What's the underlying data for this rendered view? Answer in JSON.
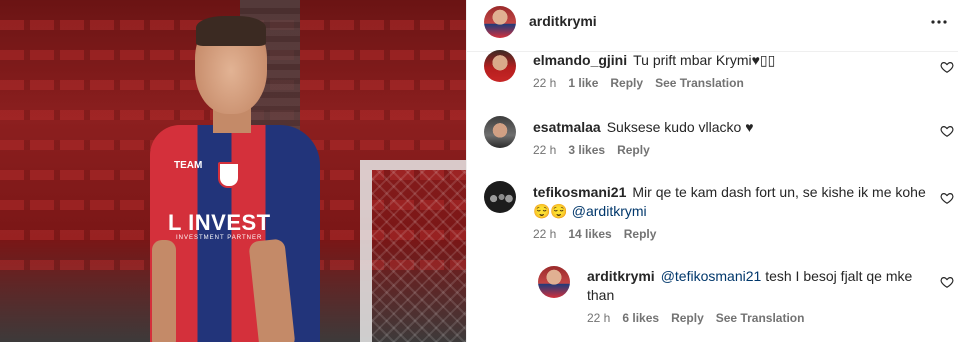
{
  "post": {
    "author": "arditkrymi",
    "more_icon": "more-horizontal-icon",
    "photo_sponsor": "L INVEST",
    "photo_sponsor_sub": "INVESTMENT PARTNER",
    "photo_kit_logo": "TEAM"
  },
  "comments": [
    {
      "user": "elmando_gjini",
      "text": "Tu prift mbar Krymi♥▯▯",
      "time": "22 h",
      "likes": "1 like",
      "reply": "Reply",
      "translation": "See Translation"
    },
    {
      "user": "esatmalaa",
      "text": "Suksese kudo vllacko ♥",
      "time": "22 h",
      "likes": "3 likes",
      "reply": "Reply"
    },
    {
      "user": "tefikosmani21",
      "text_line1": "Mir qe te kam dash fort un, se kishe ik me kohe",
      "text_line2_emoji": "😌😌",
      "mention": "@arditkrymi",
      "time": "22 h",
      "likes": "14 likes",
      "reply": "Reply"
    }
  ],
  "reply": {
    "user": "arditkrymi",
    "mention": "@tefikosmani21",
    "text_line1": "tesh I besoj fjalt qe mke",
    "text_line2": "than",
    "time": "22 h",
    "likes": "6 likes",
    "reply": "Reply",
    "translation": "See Translation"
  },
  "colors": {
    "text": "#262626",
    "meta": "#737373",
    "mention": "#00376b",
    "divider": "#efefef"
  }
}
